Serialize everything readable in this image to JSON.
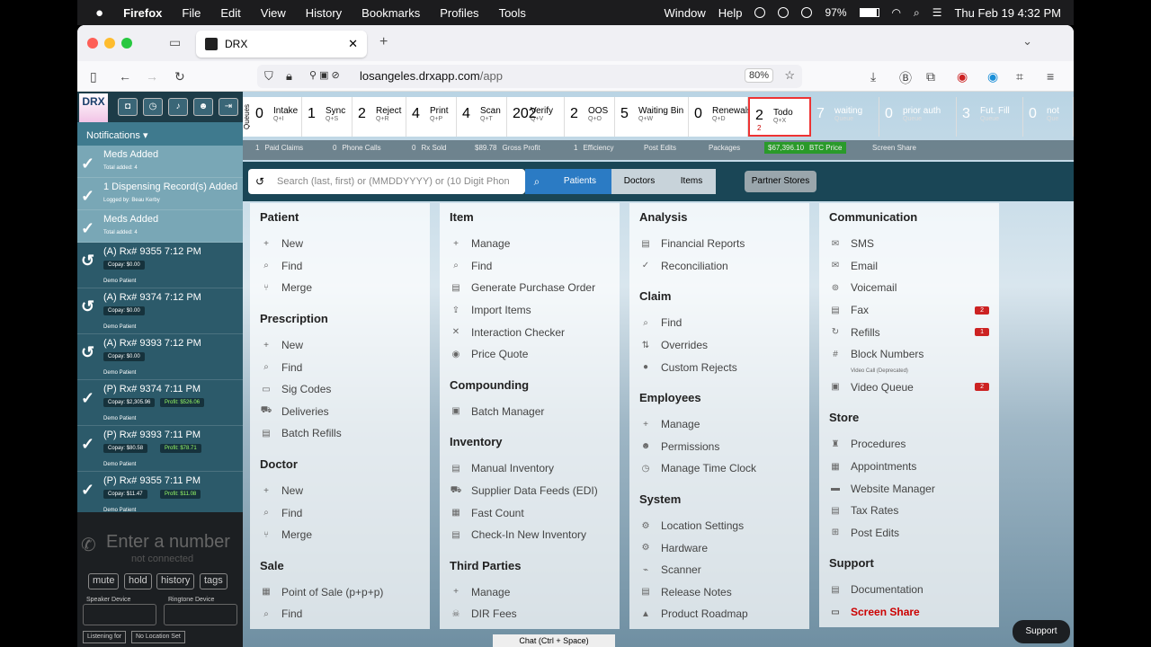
{
  "os_menu": {
    "app": "Firefox",
    "items": [
      "File",
      "Edit",
      "View",
      "History",
      "Bookmarks",
      "Profiles",
      "Tools"
    ],
    "window": "Window",
    "help": "Help",
    "battery": "97%",
    "datetime": "Thu Feb 19  4:32 PM"
  },
  "browser": {
    "tab_title": "DRX",
    "url_host": "losangeles.drxapp.com",
    "url_path": "/app",
    "zoom": "80%"
  },
  "app": {
    "logo": "DRX",
    "notifications_label": "Notifications",
    "notifications": [
      {
        "type": "check",
        "title": "Meds Added",
        "sub": "Total added: 4"
      },
      {
        "type": "check",
        "title": "1 Dispensing Record(s) Added",
        "sub": "Logged by: Beau Kerby"
      },
      {
        "type": "check",
        "title": "Meds Added",
        "sub": "Total added: 4"
      },
      {
        "type": "undo",
        "title": "(A) Rx# 9355 7:12 PM",
        "copay": "Copay: $0.00",
        "patient": "Demo Patient"
      },
      {
        "type": "undo",
        "title": "(A) Rx# 9374 7:12 PM",
        "copay": "Copay: $0.00",
        "patient": "Demo Patient"
      },
      {
        "type": "undo",
        "title": "(A) Rx# 9393 7:12 PM",
        "copay": "Copay: $0.00",
        "patient": "Demo Patient"
      },
      {
        "type": "check",
        "title": "(P) Rx# 9374 7:11 PM",
        "copay": "Copay: $2,305.96",
        "profit": "Profit: $526.06",
        "patient": "Demo Patient"
      },
      {
        "type": "check",
        "title": "(P) Rx# 9393 7:11 PM",
        "copay": "Copay: $80.58",
        "profit": "Profit: $78.71",
        "patient": "Demo Patient"
      },
      {
        "type": "check",
        "title": "(P) Rx# 9355 7:11 PM",
        "copay": "Copay: $11.47",
        "profit": "Profit: $11.08",
        "patient": "Demo Patient"
      }
    ],
    "phone": {
      "placeholder": "Enter a number",
      "status": "not connected",
      "buttons": [
        "mute",
        "hold",
        "history",
        "tags"
      ],
      "speaker_label": "Speaker Device",
      "ringtone_label": "Ringtone Device",
      "tags": [
        "Listening for",
        "No Location Set"
      ]
    },
    "queues_label": "Queues",
    "queues": [
      {
        "count": "0",
        "label": "Intake",
        "key": "Q+I"
      },
      {
        "count": "1",
        "label": "Sync",
        "key": "Q+S"
      },
      {
        "count": "2",
        "label": "Reject",
        "key": "Q+R"
      },
      {
        "count": "4",
        "label": "Print",
        "key": "Q+P"
      },
      {
        "count": "4",
        "label": "Scan",
        "key": "Q+T"
      },
      {
        "count": "202",
        "label": "Verify",
        "key": "Q+V"
      },
      {
        "count": "2",
        "label": "OOS",
        "key": "Q+O"
      },
      {
        "count": "5",
        "label": "Waiting Bin",
        "key": "Q+W"
      },
      {
        "count": "0",
        "label": "Renewals",
        "key": "Q+D"
      },
      {
        "count": "2",
        "label": "Todo",
        "key": "Q+X",
        "alert": "2"
      },
      {
        "count": "7",
        "label": "waiting",
        "key": "Queue"
      },
      {
        "count": "0",
        "label": "prior auth",
        "key": "Queue"
      },
      {
        "count": "3",
        "label": "Fut. Fill",
        "key": "Queue"
      },
      {
        "count": "0",
        "label": "not",
        "key": "Que"
      }
    ],
    "stats": [
      {
        "v": "1",
        "l": "Paid Claims"
      },
      {
        "v": "0",
        "l": "Phone Calls"
      },
      {
        "v": "0",
        "l": "Rx Sold"
      },
      {
        "v": "$89.78",
        "l": "Gross Profit"
      },
      {
        "v": "1",
        "l": "Efficiency"
      },
      {
        "v": "",
        "l": "Post Edits"
      },
      {
        "v": "",
        "l": "Packages"
      },
      {
        "v": "$67,396.10",
        "l": "BTC Price"
      },
      {
        "v": "",
        "l": "Screen Share"
      }
    ],
    "search": {
      "placeholder": "Search (last, first) or (MMDDYYYY) or (10 Digit Phon",
      "tabs": [
        "Patients",
        "Doctors",
        "Items"
      ],
      "partner": "Partner Stores"
    },
    "columns": [
      {
        "sections": [
          {
            "title": "Patient",
            "items": [
              {
                "i": "+",
                "t": "New"
              },
              {
                "i": "⌕",
                "t": "Find"
              },
              {
                "i": "⑂",
                "t": "Merge"
              }
            ]
          },
          {
            "title": "Prescription",
            "items": [
              {
                "i": "+",
                "t": "New"
              },
              {
                "i": "⌕",
                "t": "Find"
              },
              {
                "i": "▭",
                "t": "Sig Codes"
              },
              {
                "i": "⛟",
                "t": "Deliveries"
              },
              {
                "i": "▤",
                "t": "Batch Refills"
              }
            ]
          },
          {
            "title": "Doctor",
            "items": [
              {
                "i": "+",
                "t": "New"
              },
              {
                "i": "⌕",
                "t": "Find"
              },
              {
                "i": "⑂",
                "t": "Merge"
              }
            ]
          },
          {
            "title": "Sale",
            "items": [
              {
                "i": "▦",
                "t": "Point of Sale (p+p+p)"
              },
              {
                "i": "⌕",
                "t": "Find"
              }
            ]
          }
        ]
      },
      {
        "sections": [
          {
            "title": "Item",
            "items": [
              {
                "i": "+",
                "t": "Manage"
              },
              {
                "i": "⌕",
                "t": "Find"
              },
              {
                "i": "▤",
                "t": "Generate Purchase Order"
              },
              {
                "i": "⇪",
                "t": "Import Items"
              },
              {
                "i": "✕",
                "t": "Interaction Checker"
              },
              {
                "i": "◉",
                "t": "Price Quote"
              }
            ]
          },
          {
            "title": "Compounding",
            "items": [
              {
                "i": "▣",
                "t": "Batch Manager"
              }
            ]
          },
          {
            "title": "Inventory",
            "items": [
              {
                "i": "▤",
                "t": "Manual Inventory"
              },
              {
                "i": "⛟",
                "t": "Supplier Data Feeds (EDI)"
              },
              {
                "i": "▦",
                "t": "Fast Count"
              },
              {
                "i": "▤",
                "t": "Check-In New Inventory"
              }
            ]
          },
          {
            "title": "Third Parties",
            "items": [
              {
                "i": "+",
                "t": "Manage"
              },
              {
                "i": "☠",
                "t": "DIR Fees"
              }
            ]
          }
        ]
      },
      {
        "sections": [
          {
            "title": "Analysis",
            "items": [
              {
                "i": "▤",
                "t": "Financial Reports"
              },
              {
                "i": "✓",
                "t": "Reconciliation"
              }
            ]
          },
          {
            "title": "Claim",
            "items": [
              {
                "i": "⌕",
                "t": "Find"
              },
              {
                "i": "⇅",
                "t": "Overrides"
              },
              {
                "i": "●",
                "t": "Custom Rejects"
              }
            ]
          },
          {
            "title": "Employees",
            "items": [
              {
                "i": "+",
                "t": "Manage"
              },
              {
                "i": "☻",
                "t": "Permissions"
              },
              {
                "i": "◷",
                "t": "Manage Time Clock"
              }
            ]
          },
          {
            "title": "System",
            "items": [
              {
                "i": "⚙",
                "t": "Location Settings"
              },
              {
                "i": "⚙",
                "t": "Hardware"
              },
              {
                "i": "⌁",
                "t": "Scanner"
              },
              {
                "i": "▤",
                "t": "Release Notes"
              },
              {
                "i": "▲",
                "t": "Product Roadmap"
              }
            ]
          }
        ]
      },
      {
        "sections": [
          {
            "title": "Communication",
            "items": [
              {
                "i": "✉",
                "t": "SMS"
              },
              {
                "i": "✉",
                "t": "Email"
              },
              {
                "i": "⊚",
                "t": "Voicemail"
              },
              {
                "i": "▤",
                "t": "Fax",
                "badge": "2"
              },
              {
                "i": "↻",
                "t": "Refills",
                "badge": "1"
              },
              {
                "i": "#",
                "t": "Block Numbers"
              },
              {
                "i": "",
                "t": "Video Call (Deprecated)",
                "small": true
              },
              {
                "i": "▣",
                "t": "Video Queue",
                "badge": "2"
              }
            ]
          },
          {
            "title": "Store",
            "items": [
              {
                "i": "♜",
                "t": "Procedures"
              },
              {
                "i": "▦",
                "t": "Appointments"
              },
              {
                "i": "▬",
                "t": "Website Manager"
              },
              {
                "i": "▤",
                "t": "Tax Rates"
              },
              {
                "i": "⊞",
                "t": "Post Edits"
              }
            ]
          },
          {
            "title": "Support",
            "items": [
              {
                "i": "▤",
                "t": "Documentation"
              },
              {
                "i": "▭",
                "t": "Screen Share",
                "red": true
              }
            ]
          }
        ]
      }
    ],
    "chat": "Chat (Ctrl + Space)",
    "support": "Support"
  }
}
